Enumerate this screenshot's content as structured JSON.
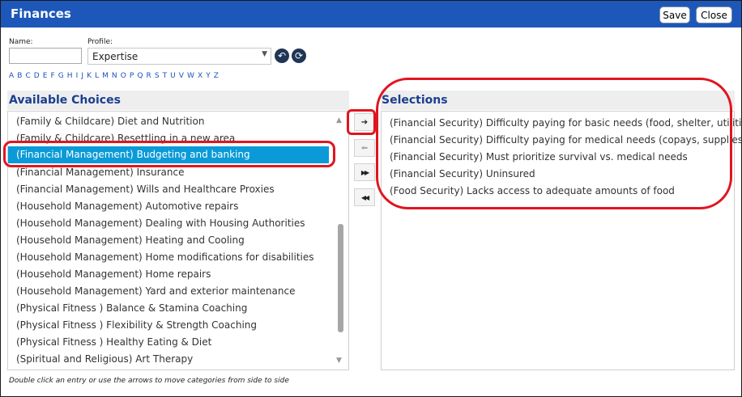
{
  "window": {
    "title": "Finances",
    "save_label": "Save",
    "close_label": "Close"
  },
  "form": {
    "name_label": "Name:",
    "name_value": "",
    "profile_label": "Profile:",
    "profile_value": "Expertise",
    "alphabet": "A B C D E F G H I J K L M N O P Q R S T U V W X Y Z"
  },
  "available": {
    "title": "Available Choices",
    "selected_index": 2,
    "items": [
      "(Family & Childcare) Diet and Nutrition",
      "(Family & Childcare) Resettling in a new area",
      "(Financial Management) Budgeting and banking",
      "(Financial Management) Insurance",
      "(Financial Management) Wills and Healthcare Proxies",
      "(Household Management) Automotive repairs",
      "(Household Management) Dealing with Housing Authorities",
      "(Household Management) Heating and Cooling",
      "(Household Management) Home modifications for disabilities",
      "(Household Management) Home repairs",
      "(Household Management) Yard and exterior maintenance",
      "(Physical Fitness ) Balance & Stamina Coaching",
      "(Physical Fitness ) Flexibility & Strength Coaching",
      "(Physical Fitness ) Healthy Eating & Diet",
      "(Spiritual and Religious) Art Therapy"
    ]
  },
  "selections": {
    "title": "Selections",
    "items": [
      "(Financial Security) Difficulty paying for basic needs (food, shelter, utilities)",
      "(Financial Security) Difficulty paying for medical needs (copays, supplies)",
      "(Financial Security) Must prioritize survival vs. medical needs",
      "(Financial Security) Uninsured",
      "(Food Security) Lacks access to adequate amounts of food"
    ]
  },
  "arrows": {
    "move_right": "➔",
    "move_left": "⬅",
    "move_all_right": "▶▶",
    "move_all_left": "◀◀"
  },
  "icons": {
    "undo": "↶",
    "refresh": "⟳"
  },
  "hint": "Double click an entry or use the arrows to move categories from side to side",
  "colors": {
    "titlebar": "#1d57b9",
    "selected_row": "#0a9ad8",
    "annotation": "#e0151f",
    "section_title": "#1a3f8f"
  }
}
